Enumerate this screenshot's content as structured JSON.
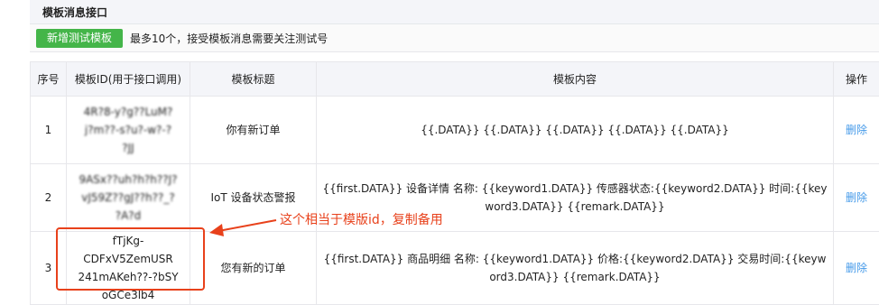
{
  "section": {
    "title": "模板消息接口"
  },
  "toolbar": {
    "add_label": "新增测试模板",
    "tip": "最多10个，接受模板消息需要关注测试号"
  },
  "table": {
    "headers": [
      "序号",
      "模板ID(用于接口调用)",
      "模板标题",
      "模板内容",
      "操作"
    ],
    "rows": [
      {
        "index": "1",
        "id_lines": [
          "4R?8-y?g??LuM?",
          "j?m??-s?u?-w?-?",
          "?JJ"
        ],
        "title": "你有新订单",
        "content": "{{.DATA}} {{.DATA}} {{.DATA}} {{.DATA}} {{.DATA}}",
        "action": "删除"
      },
      {
        "index": "2",
        "id_lines": [
          "9ASx??uh?h?h??J?",
          "vJ59Z??gJ??h??_?",
          "?A?d"
        ],
        "title": "IoT 设备状态警报",
        "content": "{{first.DATA}} 设备详情 名称: {{keyword1.DATA}} 传感器状态:{{keyword2.DATA}} 时间:{{keyword3.DATA}} {{remark.DATA}}",
        "action": "删除"
      },
      {
        "index": "3",
        "id_lines": [
          "fTjKg-CDFxV5ZemUSR",
          "241mAKeh??-?bSY",
          "oGCe3lb4"
        ],
        "title": "您有新的订单",
        "content": "{{first.DATA}} 商品明细 名称: {{keyword1.DATA}} 价格:{{keyword2.DATA}} 交易时间:{{keyword3.DATA}} {{remark.DATA}}",
        "action": "删除"
      }
    ]
  },
  "annotation": {
    "text": "这个相当于模版id，复制备用",
    "color": "#e8411b"
  },
  "colors": {
    "accent_green": "#44b549",
    "link_blue": "#459ae9",
    "header_bg": "#f4f5f9"
  }
}
